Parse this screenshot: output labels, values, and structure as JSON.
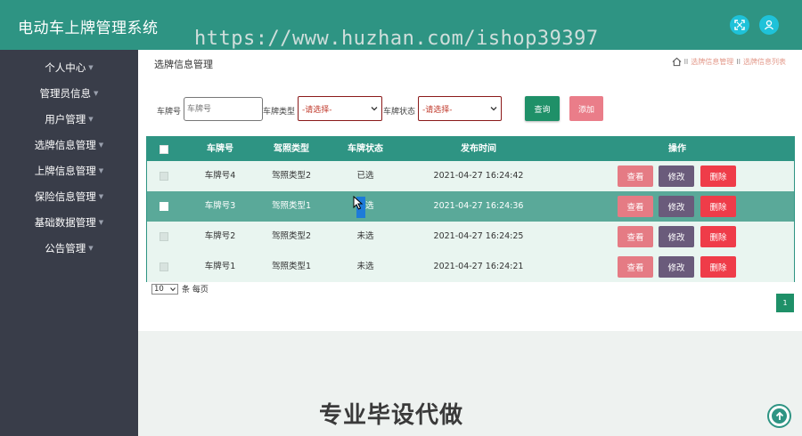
{
  "app": {
    "title": "电动车上牌管理系统"
  },
  "watermark": "https://www.huzhan.com/ishop39397",
  "sidebar": {
    "items": [
      {
        "label": "个人中心"
      },
      {
        "label": "管理员信息"
      },
      {
        "label": "用户管理"
      },
      {
        "label": "选牌信息管理"
      },
      {
        "label": "上牌信息管理"
      },
      {
        "label": "保险信息管理"
      },
      {
        "label": "基础数据管理"
      },
      {
        "label": "公告管理"
      }
    ]
  },
  "page": {
    "title": "选牌信息管理",
    "breadcrumb": [
      "选牌信息管理",
      "选牌信息列表"
    ],
    "breadcrumb_sep": "II"
  },
  "filters": {
    "plate_label": "车牌号",
    "plate_placeholder": "车牌号",
    "type_label": "车牌类型",
    "type_value": "-请选择-",
    "status_label": "车牌状态",
    "status_value": "-请选择-",
    "query_label": "查询",
    "add_label": "添加"
  },
  "table": {
    "columns": [
      "车牌号",
      "驾照类型",
      "车牌状态",
      "发布时间",
      "操作"
    ],
    "actions": {
      "view": "查看",
      "edit": "修改",
      "delete": "删除"
    },
    "rows": [
      {
        "plate": "车牌号4",
        "license_type": "驾照类型2",
        "status": "已选",
        "time": "2021-04-27 16:24:42"
      },
      {
        "plate": "车牌号3",
        "license_type": "驾照类型1",
        "status": "已选",
        "time": "2021-04-27 16:24:36"
      },
      {
        "plate": "车牌号2",
        "license_type": "驾照类型2",
        "status": "未选",
        "time": "2021-04-27 16:24:25"
      },
      {
        "plate": "车牌号1",
        "license_type": "驾照类型1",
        "status": "未选",
        "time": "2021-04-27 16:24:21"
      }
    ]
  },
  "pagination": {
    "page_size": "10",
    "per_page_label": "条 每页",
    "current_page": "1"
  },
  "slogan": "专业毕设代做",
  "colors": {
    "primary": "#2e9483",
    "sidebar": "#393d49",
    "query": "#1f9068",
    "add": "#ea7d89",
    "view": "#e57b84",
    "edit": "#6a5b7b",
    "delete": "#ef3c49"
  },
  "icons": {
    "top_left_button": "fullscreen-icon",
    "top_right_button": "user-icon",
    "breadcrumb": "home-icon",
    "scroll": "arrow-up-icon"
  }
}
